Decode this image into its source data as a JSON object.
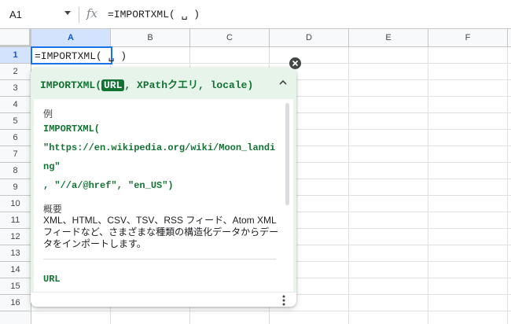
{
  "formula_bar": {
    "cell_ref": "A1",
    "fx_label": "fx",
    "formula": "=IMPORTXML( ␣ )"
  },
  "columns": [
    "A",
    "B",
    "C",
    "D",
    "E",
    "F"
  ],
  "rows": [
    "1",
    "2",
    "3",
    "4",
    "5",
    "6",
    "7",
    "8",
    "9",
    "10",
    "11",
    "12",
    "13",
    "14",
    "15",
    "16"
  ],
  "active_cell": {
    "ref": "A1",
    "content": "=IMPORTXML( ␣ )"
  },
  "help_popup": {
    "fn_name": "IMPORTXML(",
    "active_arg": "URL",
    "rest_args": ", XPathクエリ, locale)",
    "example_label": "例",
    "example_lines": [
      "IMPORTXML(",
      "\"https://en.wikipedia.org/wiki/Moon_landi",
      "ng\"",
      ", \"//a/@href\", \"en_US\")"
    ],
    "summary_label": "概要",
    "summary_text": "XML、HTML、CSV、TSV、RSS フィード、Atom XML フィードなど、さまざまな種類の構造化データからデータをインポートします。",
    "url_label": "URL"
  },
  "colors": {
    "accent": "#1a73e8",
    "header_selected_bg": "#d3e3fd",
    "help_green": "#137333",
    "help_header_bg": "#e6f4ea"
  }
}
